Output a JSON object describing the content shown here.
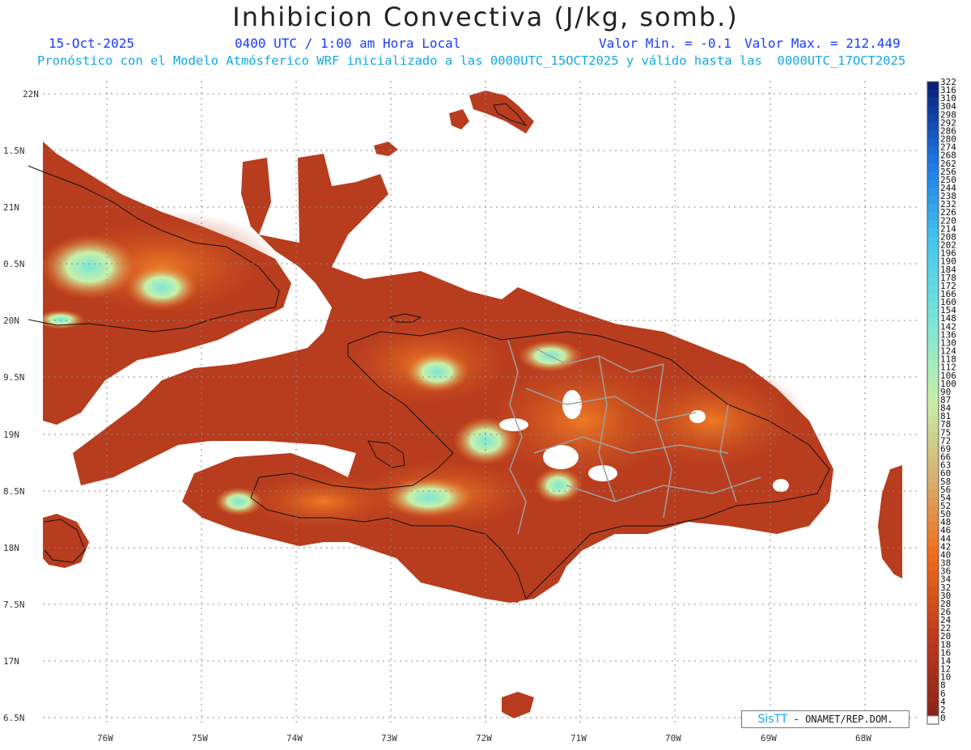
{
  "header": {
    "title": "Inhibicion Convectiva (J/kg, somb.)",
    "date": "15-Oct-2025",
    "time": "0400 UTC / 1:00 am Hora Local",
    "min": "Valor Min. = -0.1",
    "max": "Valor Max. = 212.449",
    "forecast": "Pronóstico con el Modelo Atmósferico WRF inicializado a las 0000UTC_15OCT2025 y válido hasta las  0000UTC_17OCT2025"
  },
  "axes": {
    "lat_labels": [
      "22N",
      "1.5N",
      "21N",
      "0.5N",
      "20N",
      "9.5N",
      "19N",
      "8.5N",
      "18N",
      "7.5N",
      "17N",
      "6.5N"
    ],
    "lon_labels": [
      "76W",
      "75W",
      "74W",
      "73W",
      "72W",
      "71W",
      "70W",
      "69W",
      "68W"
    ]
  },
  "colorbar": {
    "labels": [
      "322",
      "316",
      "310",
      "304",
      "298",
      "292",
      "286",
      "280",
      "274",
      "268",
      "262",
      "256",
      "250",
      "244",
      "238",
      "232",
      "226",
      "220",
      "214",
      "208",
      "202",
      "196",
      "190",
      "184",
      "178",
      "172",
      "166",
      "160",
      "154",
      "148",
      "142",
      "136",
      "130",
      "124",
      "118",
      "112",
      "106",
      "100",
      "90",
      "87",
      "84",
      "81",
      "78",
      "75",
      "72",
      "69",
      "66",
      "63",
      "60",
      "58",
      "56",
      "54",
      "52",
      "50",
      "48",
      "46",
      "44",
      "42",
      "40",
      "38",
      "36",
      "34",
      "32",
      "30",
      "28",
      "26",
      "24",
      "22",
      "20",
      "18",
      "16",
      "14",
      "12",
      "10",
      "8",
      "6",
      "4",
      "2",
      "0"
    ],
    "colors": {
      "dark_blue": "#0a1f7a",
      "mid_blue": "#1e7ae8",
      "light_blue": "#45c8ee",
      "cyan": "#7ae6d8",
      "pale_green": "#c8f0a8",
      "tan": "#d8b070",
      "orange": "#f06a18",
      "brick": "#c03a1c",
      "dark_brown": "#8b2418"
    }
  },
  "credit": {
    "brand": "SisTT",
    "org": "- ONAMET/REP.DOM."
  }
}
